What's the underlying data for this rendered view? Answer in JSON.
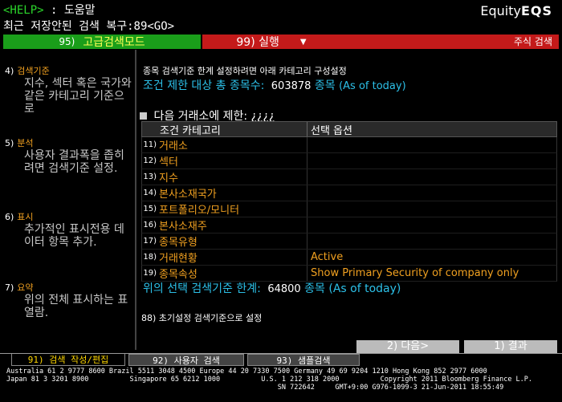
{
  "header": {
    "help_tag": "<HELP>",
    "help_sep": ":",
    "help_label": "도움말",
    "logo_prefix": "Equity",
    "logo_code": "EQS",
    "recent_line": "최근 저장안된 검색 복구:89<GO>"
  },
  "actions": {
    "btn95_num": "95)",
    "btn95_label": "고급검색모드",
    "btn99_label": "99) 실행",
    "btn99_caret": "▼",
    "equity_label": "주식 검색"
  },
  "sidebar": [
    {
      "num": "4)",
      "title": "검색기준",
      "body": "지수, 섹터 혹은 국가와 같은 카테고리 기준으로"
    },
    {
      "num": "5)",
      "title": "분석",
      "body": "사용자 결과폭을 좁히려면 검색기준 설정."
    },
    {
      "num": "6)",
      "title": "표시",
      "body": "추가적인 표시전용 데이터 항목 추가."
    },
    {
      "num": "7)",
      "title": "요약",
      "body": "위의 전체 표시하는 표 열람."
    }
  ],
  "main": {
    "desc": "종목 검색기준 한계 설정하려면 아래 카테고리 구성설정",
    "total_label": "조건 제한 대상 총 종목수:",
    "total_count": "603878",
    "total_unit": "종목",
    "total_asof": "(As of today)",
    "restrict_label": "다음 거래소에 제한:",
    "restrict_value": "¿¿¿¿",
    "table_headers": [
      "조건 카테고리",
      "선택 옵션"
    ],
    "rows": [
      {
        "no": "11)",
        "name": "거래소",
        "option": ""
      },
      {
        "no": "12)",
        "name": "섹터",
        "option": ""
      },
      {
        "no": "13)",
        "name": "지수",
        "option": ""
      },
      {
        "no": "14)",
        "name": "본사소재국가",
        "option": ""
      },
      {
        "no": "15)",
        "name": "포트폴리오/모니터",
        "option": ""
      },
      {
        "no": "16)",
        "name": "본사소재주",
        "option": ""
      },
      {
        "no": "17)",
        "name": "종목유형",
        "option": ""
      },
      {
        "no": "18)",
        "name": "거래현황",
        "option": "Active"
      },
      {
        "no": "19)",
        "name": "종목속성",
        "option": "Show Primary Security of company only"
      }
    ],
    "selected_label": "위의 선택 검색기준 한계:",
    "selected_count": "64800",
    "selected_unit": "종목",
    "selected_asof": "(As of today)",
    "reset_label": "88) 초기설정 검색기준으로 설정"
  },
  "buttons": {
    "next": "2) 다음>",
    "results": "1) 결과"
  },
  "tabs": [
    "91) 검색 작성/편집",
    "92) 사용자 검색",
    "93) 샘플검색"
  ],
  "footer": {
    "line1": "Australia 61 2 9777 8600 Brazil 5511 3048 4500 Europe 44 20 7330 7500 Germany 49 69 9204 1210 Hong Kong 852 2977 6000",
    "line2": "Japan 81 3 3201 8900          Singapore 65 6212 1000          U.S. 1 212 318 2000          Copyright 2011 Bloomberg Finance L.P.",
    "line3": "                                                                  SN 722642     GMT+9:00 G976-1099-3 21-Jun-2011 18:55:49"
  },
  "colors": {
    "accent_orange": "#f0a020",
    "accent_cyan": "#2cc0e8",
    "green": "#1a9e1a",
    "red": "#c41a1a"
  }
}
